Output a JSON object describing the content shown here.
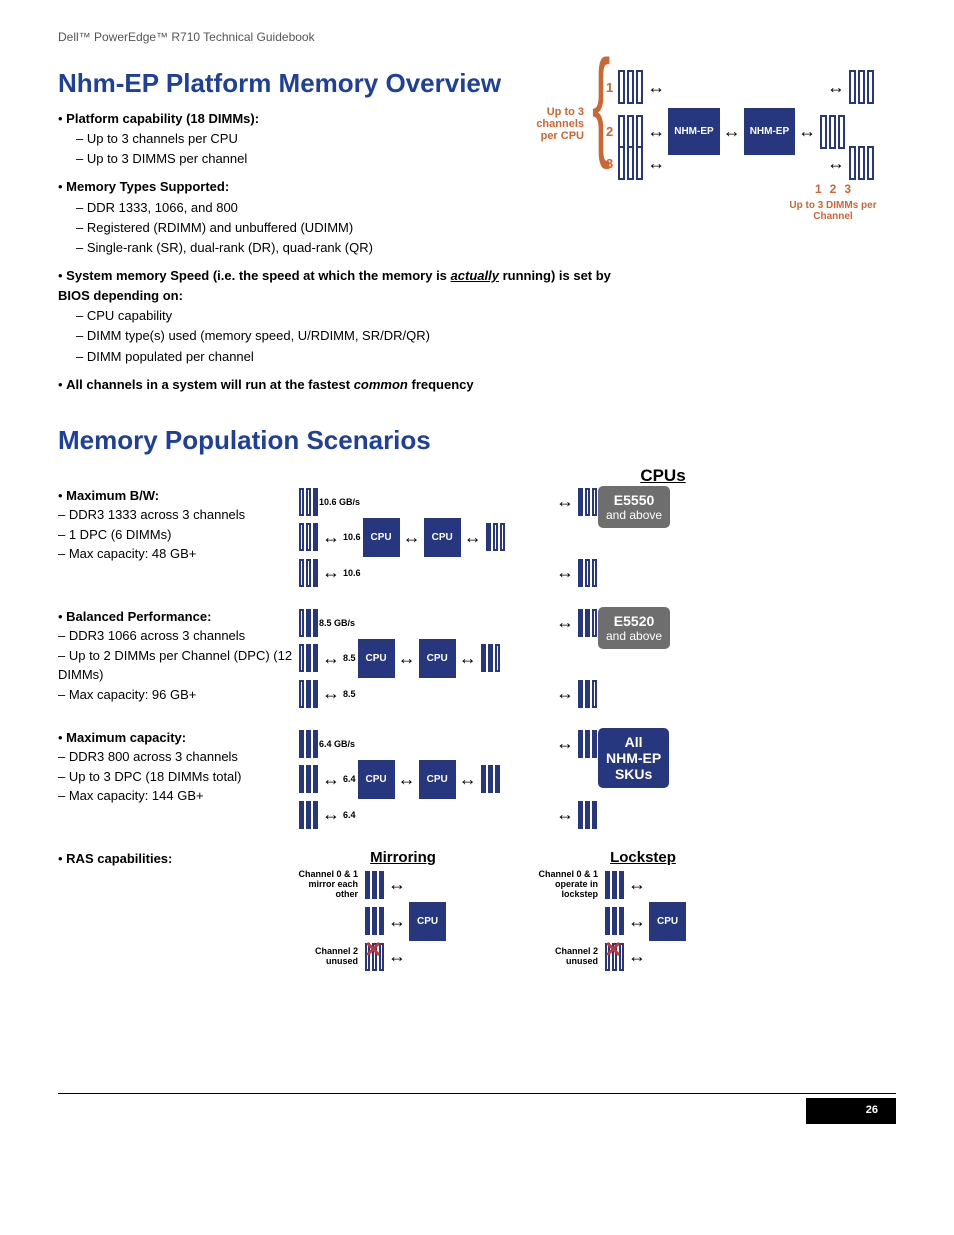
{
  "header": "Dell™ PowerEdge™ R710 Technical Guidebook",
  "page_number": "26",
  "section1": {
    "title": "Nhm-EP Platform Memory Overview",
    "b1_title": "Platform capability (18 DIMMs):",
    "b1_s1": "Up to 3 channels per CPU",
    "b1_s2": "Up to 3 DIMMS per channel",
    "b2_title": "Memory Types Supported:",
    "b2_s1": "DDR 1333, 1066, and 800",
    "b2_s2": "Registered (RDIMM) and unbuffered (UDIMM)",
    "b2_s3": "Single-rank (SR), dual-rank (DR), quad-rank (QR)",
    "b3_prefix": "System memory Speed (i.e. the speed at which the memory is ",
    "b3_actually": "actually",
    "b3_suffix": " running) is set by BIOS depending on:",
    "b3_s1": "CPU capability",
    "b3_s2": "DIMM type(s) used (memory speed, U/RDIMM, SR/DR/QR)",
    "b3_s3": "DIMM populated per channel",
    "b4_prefix": "All channels in a system will run at the fastest ",
    "b4_common": "common",
    "b4_suffix": " frequency",
    "diag": {
      "ch_label": "Up to 3 channels per CPU",
      "ch1": "1",
      "ch2": "2",
      "ch3": "3",
      "nhmep": "NHM-EP",
      "bottom_label": "Up to 3 DIMMs per Channel",
      "n1": "1",
      "n2": "2",
      "n3": "3"
    }
  },
  "section2": {
    "title": "Memory Population Scenarios",
    "cpus_hdr": "CPUs",
    "arrow": "↔",
    "cpu": "CPU",
    "scen1": {
      "title": "Maximum B/W:",
      "s1": "DDR3 1333 across 3 channels",
      "s2": "1 DPC (6 DIMMs)",
      "s3": "Max capacity: 48 GB+",
      "gb1": "10.6 GB/s",
      "gb2": "10.6",
      "gb3": "10.6",
      "cpu_label_big": "E5550",
      "cpu_label_small": "and above"
    },
    "scen2": {
      "title": "Balanced Performance:",
      "s1": "DDR3 1066 across 3 channels",
      "s2": "Up to 2 DIMMs per Channel (DPC) (12 DIMMs)",
      "s3": "Max capacity: 96 GB+",
      "gb1": "8.5 GB/s",
      "gb2": "8.5",
      "gb3": "8.5",
      "cpu_label_big": "E5520",
      "cpu_label_small": "and above"
    },
    "scen3": {
      "title": "Maximum capacity:",
      "s1": "DDR3 800 across 3 channels",
      "s2": "Up to 3 DPC (18 DIMMs total)",
      "s3": "Max capacity: 144 GB+",
      "gb1": "6.4 GB/s",
      "gb2": "6.4",
      "gb3": "6.4",
      "cpu_label_l1": "All",
      "cpu_label_l2": "NHM-EP",
      "cpu_label_l3": "SKUs"
    },
    "ras": {
      "title": "RAS capabilities:",
      "mirroring": "Mirroring",
      "lockstep": "Lockstep",
      "mirr_l1": "Channel 0 & 1 mirror each other",
      "mirr_l2": "Channel 2 unused",
      "lock_l1": "Channel 0 & 1 operate in lockstep",
      "lock_l2": "Channel 2 unused"
    }
  }
}
